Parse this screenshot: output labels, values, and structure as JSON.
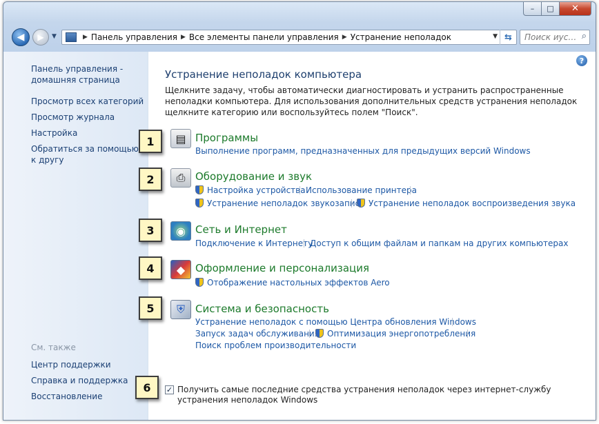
{
  "window": {
    "min_glyph": "–",
    "max_glyph": "□",
    "close_glyph": "✕"
  },
  "nav": {
    "back_glyph": "◀",
    "fwd_glyph": "▶",
    "breadcrumbs": [
      "Панель управления",
      "Все элементы панели управления",
      "Устранение неполадок"
    ],
    "search_placeholder": "Поиск иус…"
  },
  "sidebar": {
    "home_link": "Панель управления - домашняя страница",
    "links": [
      "Просмотр всех категорий",
      "Просмотр журнала",
      "Настройка",
      "Обратиться за помощью к другу"
    ],
    "see_also": "См. также",
    "see_also_links": [
      "Центр поддержки",
      "Справка и поддержка",
      "Восстановление"
    ]
  },
  "main": {
    "title": "Устранение неполадок компьютера",
    "intro": "Щелкните задачу, чтобы автоматически диагностировать и устранить распространенные неполадки компьютера. Для использования дополнительных средств устранения неполадок щелкните категорию или воспользуйтесь полем \"Поиск\".",
    "categories": [
      {
        "title": "Программы",
        "icon": "programs-icon",
        "tasks": [
          "Выполнение программ, предназначенных для предыдущих версий Windows"
        ]
      },
      {
        "title": "Оборудование и звук",
        "icon": "hardware-sound-icon",
        "tasks": [
          "Настройка устройства",
          "Использование принтера",
          "Устранение неполадок звукозаписи",
          "Устранение неполадок воспроизведения звука"
        ]
      },
      {
        "title": "Сеть и Интернет",
        "icon": "network-icon",
        "tasks": [
          "Подключение к Интернету",
          "Доступ к общим файлам и папкам на других компьютерах"
        ]
      },
      {
        "title": "Оформление и персонализация",
        "icon": "appearance-icon",
        "tasks": [
          "Отображение настольных эффектов Aero"
        ]
      },
      {
        "title": "Система и безопасность",
        "icon": "system-security-icon",
        "tasks": [
          "Устранение неполадок с помощью Центра обновления Windows",
          "Запуск задач обслуживания",
          "Оптимизация энергопотребления",
          "Поиск проблем производительности"
        ]
      }
    ],
    "online_checkbox": {
      "checked": true,
      "label": "Получить самые последние средства устранения неполадок через интернет-службу устранения неполадок Windows"
    }
  },
  "callouts": [
    "1",
    "2",
    "3",
    "4",
    "5",
    "6"
  ]
}
